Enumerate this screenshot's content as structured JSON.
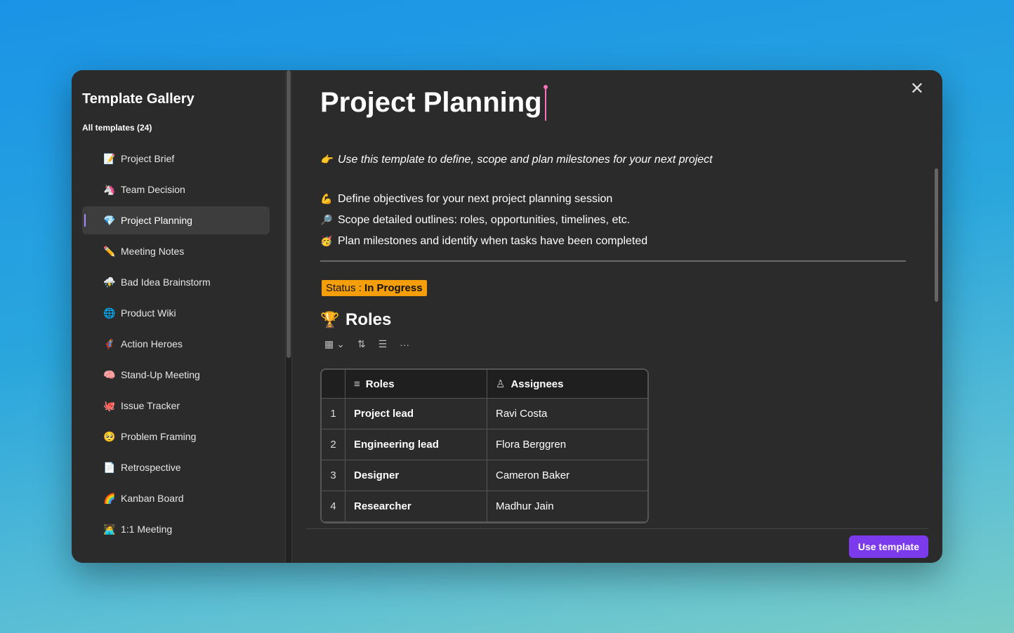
{
  "sidebar": {
    "title": "Template Gallery",
    "subtitle": "All templates (24)",
    "items": [
      {
        "emoji": "📝",
        "label": "Project Brief",
        "icon": "memo-icon"
      },
      {
        "emoji": "🦄",
        "label": "Team Decision",
        "icon": "unicorn-icon"
      },
      {
        "emoji": "💎",
        "label": "Project Planning",
        "icon": "gem-icon",
        "active": true
      },
      {
        "emoji": "✏️",
        "label": "Meeting Notes",
        "icon": "pencil-icon"
      },
      {
        "emoji": "⛈️",
        "label": "Bad Idea Brainstorm",
        "icon": "storm-icon"
      },
      {
        "emoji": "🌐",
        "label": "Product Wiki",
        "icon": "globe-icon"
      },
      {
        "emoji": "🦸",
        "label": "Action Heroes",
        "icon": "hero-icon"
      },
      {
        "emoji": "🧠",
        "label": "Stand-Up Meeting",
        "icon": "brain-icon"
      },
      {
        "emoji": "🐙",
        "label": "Issue Tracker",
        "icon": "octopus-icon"
      },
      {
        "emoji": "🥺",
        "label": "Problem Framing",
        "icon": "pleading-face-icon"
      },
      {
        "emoji": "📄",
        "label": "Retrospective",
        "icon": "page-icon"
      },
      {
        "emoji": "🌈",
        "label": "Kanban Board",
        "icon": "rainbow-icon"
      },
      {
        "emoji": "🧑‍💻",
        "label": "1:1 Meeting",
        "icon": "technologist-icon"
      }
    ]
  },
  "doc": {
    "title": "Project Planning",
    "intro": {
      "emoji": "👉",
      "text": "Use this template to define, scope and plan milestones for your next project"
    },
    "bullets": [
      {
        "emoji": "💪",
        "text": "Define objectives for your next project planning session"
      },
      {
        "emoji": "🔎",
        "text": "Scope detailed outlines: roles, opportunities, timelines, etc."
      },
      {
        "emoji": "🥳",
        "text": "Plan milestones and identify when tasks have been completed"
      }
    ],
    "status": {
      "label": "Status : ",
      "value": "In Progress",
      "color": "#f59e0b"
    },
    "section": {
      "emoji": "🏆",
      "title": "Roles"
    },
    "table": {
      "headers": [
        "Roles",
        "Assignees"
      ],
      "rows": [
        {
          "n": "1",
          "role": "Project lead",
          "assignee": "Ravi Costa"
        },
        {
          "n": "2",
          "role": "Engineering lead",
          "assignee": "Flora Berggren"
        },
        {
          "n": "3",
          "role": "Designer",
          "assignee": "Cameron Baker"
        },
        {
          "n": "4",
          "role": "Researcher",
          "assignee": "Madhur Jain"
        }
      ]
    }
  },
  "footer": {
    "use_template": "Use template"
  },
  "colors": {
    "accent": "#7c3aed",
    "status": "#f59e0b"
  }
}
